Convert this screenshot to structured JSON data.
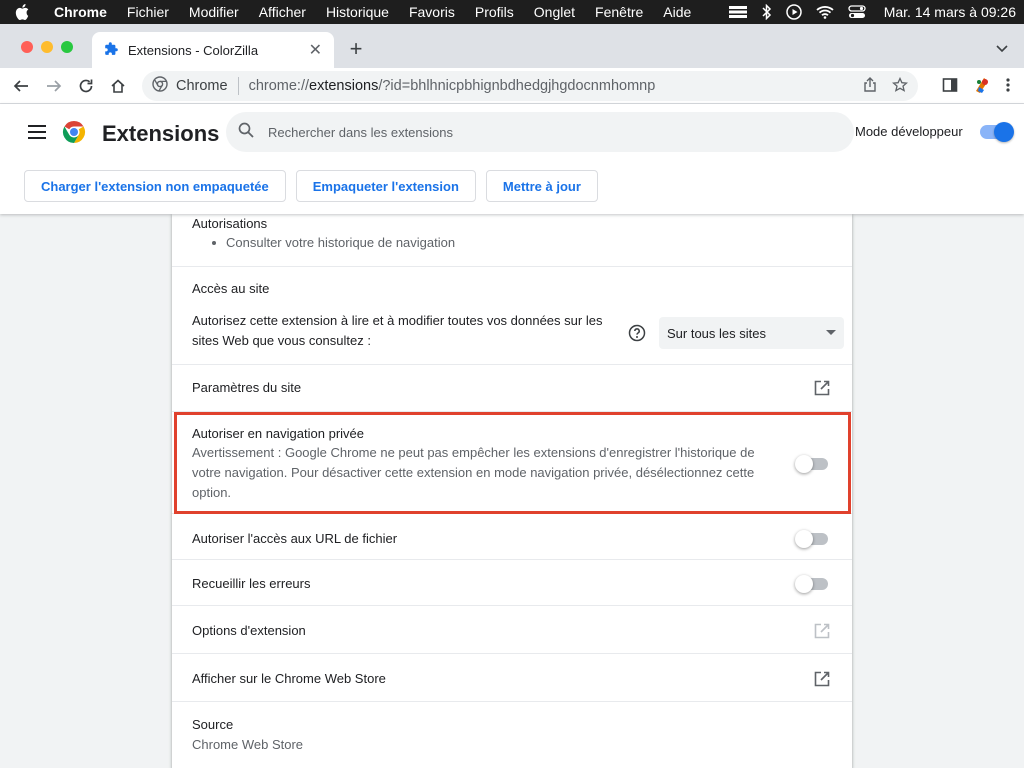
{
  "menubar": {
    "app": "Chrome",
    "items": [
      "Fichier",
      "Modifier",
      "Afficher",
      "Historique",
      "Favoris",
      "Profils",
      "Onglet",
      "Fenêtre",
      "Aide"
    ],
    "clock": "Mar. 14 mars à 09:26"
  },
  "tab": {
    "title": "Extensions - ColorZilla"
  },
  "omnibox": {
    "site_label": "Chrome",
    "url_scheme": "chrome://",
    "url_host": "extensions",
    "url_rest": "/?id=bhlhnicpbhignbdhedgjhgdocnmhomnp"
  },
  "header": {
    "title": "Extensions",
    "search_placeholder": "Rechercher dans les extensions",
    "devmode_label": "Mode développeur",
    "devmode_on": true,
    "buttons": [
      "Charger l'extension non empaquetée",
      "Empaqueter l'extension",
      "Mettre à jour"
    ]
  },
  "details": {
    "permissions_title": "Autorisations",
    "permissions": [
      "Consulter votre historique de navigation"
    ],
    "site_access_title": "Accès au site",
    "site_access_desc_line1": "Autorisez cette extension à lire et à modifier toutes vos données sur les",
    "site_access_desc_line2": "sites Web que vous consultez :",
    "site_access_value": "Sur tous les sites",
    "site_settings": "Paramètres du site",
    "incognito_title": "Autoriser en navigation privée",
    "incognito_warning_line1": "Avertissement : Google Chrome ne peut pas empêcher les extensions d'enregistrer l'historique de",
    "incognito_warning_line2": "votre navigation. Pour désactiver cette extension en mode navigation privée, désélectionnez cette",
    "incognito_warning_line3": "option.",
    "file_urls": "Autoriser l'accès aux URL de fichier",
    "collect_errors": "Recueillir les erreurs",
    "options": "Options d'extension",
    "webstore": "Afficher sur le Chrome Web Store",
    "source_title": "Source",
    "source_value": "Chrome Web Store"
  },
  "colors": {
    "accent": "#1a73e8",
    "highlight": "#e0412d"
  }
}
